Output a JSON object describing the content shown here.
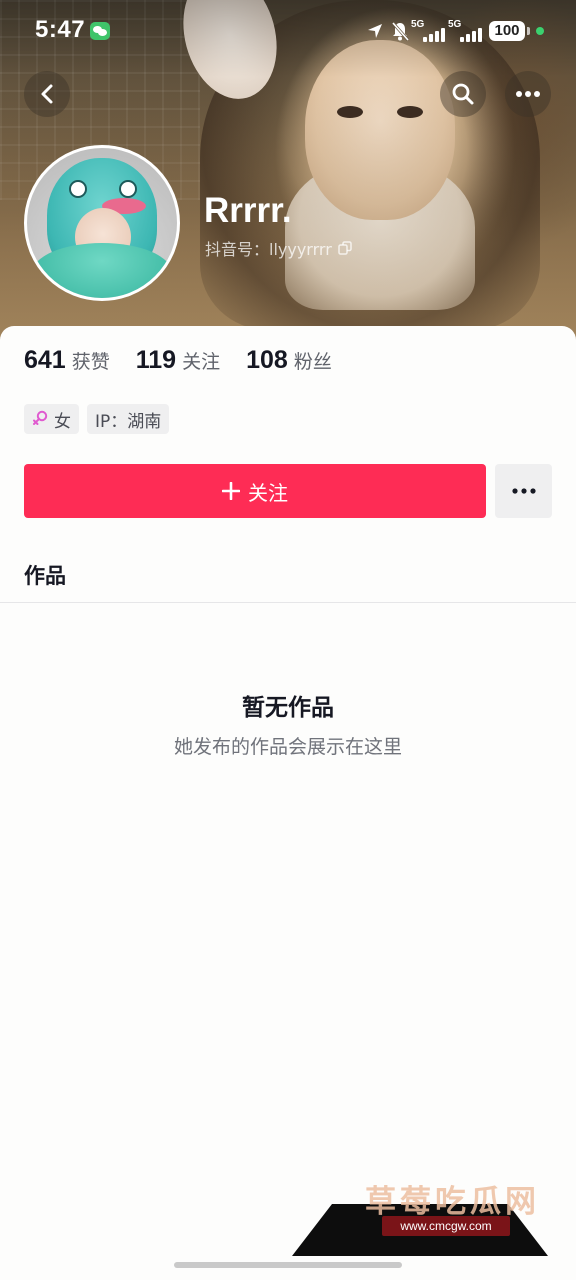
{
  "status_bar": {
    "time": "5:47",
    "network_1": "5G",
    "network_2": "5G",
    "battery": "100"
  },
  "profile": {
    "name": "Rrrrr.",
    "id_label": "抖音号：llyyyrrrr"
  },
  "stats": [
    {
      "value": "641",
      "label": "获赞"
    },
    {
      "value": "119",
      "label": "关注"
    },
    {
      "value": "108",
      "label": "粉丝"
    }
  ],
  "tags": {
    "gender": "女",
    "ip": "IP：湖南"
  },
  "actions": {
    "follow_label": "关注"
  },
  "tabs": {
    "works": "作品"
  },
  "empty_state": {
    "title": "暂无作品",
    "subtitle": "她发布的作品会展示在这里"
  },
  "watermark": {
    "title": "草莓吃瓜网",
    "url": "www.cmcgw.com"
  },
  "colors": {
    "accent": "#fe2c55",
    "female": "#e05ad0"
  },
  "icons": [
    "back-icon",
    "search-icon",
    "more-icon",
    "copy-icon",
    "female-icon",
    "plus-icon",
    "location-icon",
    "silent-icon",
    "wechat-icon"
  ]
}
